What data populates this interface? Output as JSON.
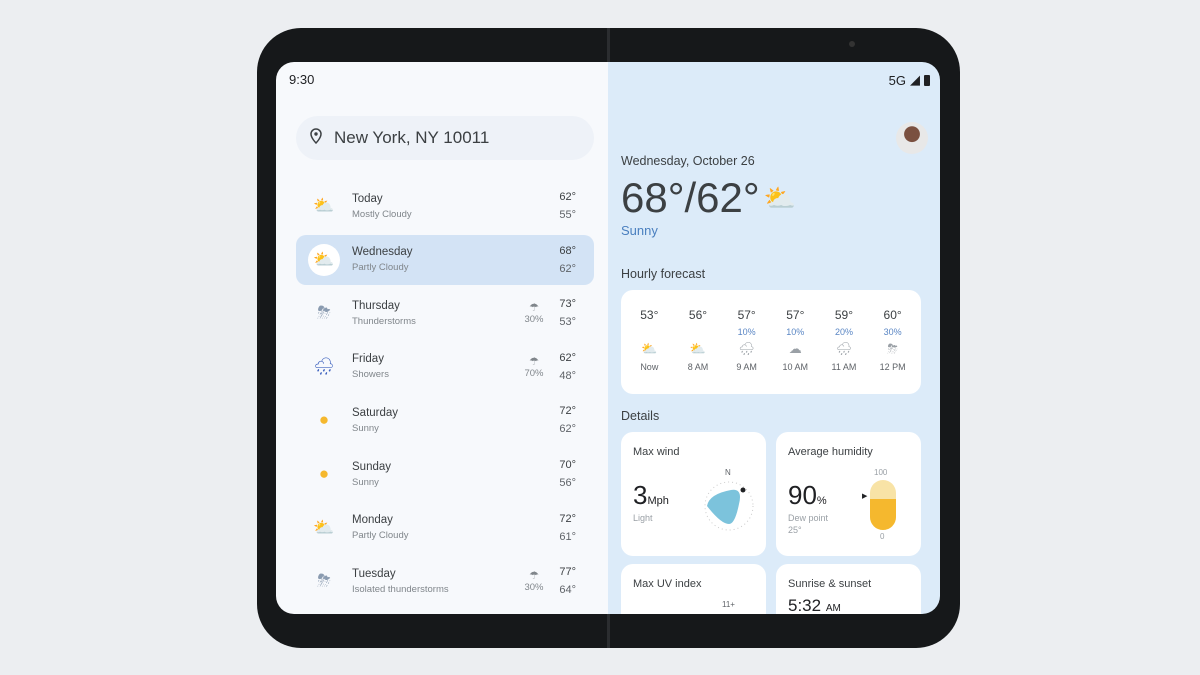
{
  "status": {
    "time": "9:30",
    "network": "5G"
  },
  "search": {
    "location": "New York, NY 10011"
  },
  "days": [
    {
      "name": "Today",
      "cond": "Mostly Cloudy",
      "hi": "62°",
      "lo": "55°",
      "precip": "",
      "icon": "partly-cloudy",
      "glyph": "⛅"
    },
    {
      "name": "Wednesday",
      "cond": "Partly Cloudy",
      "hi": "68°",
      "lo": "62°",
      "precip": "",
      "icon": "partly-cloudy",
      "glyph": "⛅",
      "selected": true
    },
    {
      "name": "Thursday",
      "cond": "Thunderstorms",
      "hi": "73°",
      "lo": "53°",
      "precip": "30%",
      "icon": "thunderstorm",
      "glyph": "⛈"
    },
    {
      "name": "Friday",
      "cond": "Showers",
      "hi": "62°",
      "lo": "48°",
      "precip": "70%",
      "icon": "showers",
      "glyph": "🌧"
    },
    {
      "name": "Saturday",
      "cond": "Sunny",
      "hi": "72°",
      "lo": "62°",
      "precip": "",
      "icon": "sun",
      "glyph": "●"
    },
    {
      "name": "Sunday",
      "cond": "Sunny",
      "hi": "70°",
      "lo": "56°",
      "precip": "",
      "icon": "sun",
      "glyph": "●"
    },
    {
      "name": "Monday",
      "cond": "Partly Cloudy",
      "hi": "72°",
      "lo": "61°",
      "precip": "",
      "icon": "partly-cloudy",
      "glyph": "⛅"
    },
    {
      "name": "Tuesday",
      "cond": "Isolated thunderstorms",
      "hi": "77°",
      "lo": "64°",
      "precip": "30%",
      "icon": "thunderstorm",
      "glyph": "⛈"
    }
  ],
  "current": {
    "date": "Wednesday, October 26",
    "temps": "68°/62°",
    "cond": "Sunny"
  },
  "hourly_title": "Hourly forecast",
  "hourly": [
    {
      "t": "53°",
      "p": "",
      "l": "Now",
      "glyph": "⛅"
    },
    {
      "t": "56°",
      "p": "",
      "l": "8 AM",
      "glyph": "⛅"
    },
    {
      "t": "57°",
      "p": "10%",
      "l": "9 AM",
      "glyph": "🌧"
    },
    {
      "t": "57°",
      "p": "10%",
      "l": "10 AM",
      "glyph": "☁"
    },
    {
      "t": "59°",
      "p": "20%",
      "l": "11 AM",
      "glyph": "🌧"
    },
    {
      "t": "60°",
      "p": "30%",
      "l": "12 PM",
      "glyph": "⛈"
    }
  ],
  "details_title": "Details",
  "wind": {
    "title": "Max wind",
    "value": "3",
    "unit": "Mph",
    "desc": "Light",
    "dir": "N"
  },
  "humidity": {
    "title": "Average humidity",
    "value": "90",
    "unit": "%",
    "dew_label": "Dew point",
    "dew": "25°",
    "max": "100",
    "min": "0",
    "level": 0.9
  },
  "uv": {
    "title": "Max UV index",
    "max": "11+"
  },
  "sun": {
    "title": "Sunrise & sunset",
    "sunrise": "5:32",
    "unit": "AM"
  },
  "colors": {
    "accent": "#4a7fbf",
    "sun": "#f5b82e",
    "wind": "#7cc3dc"
  }
}
